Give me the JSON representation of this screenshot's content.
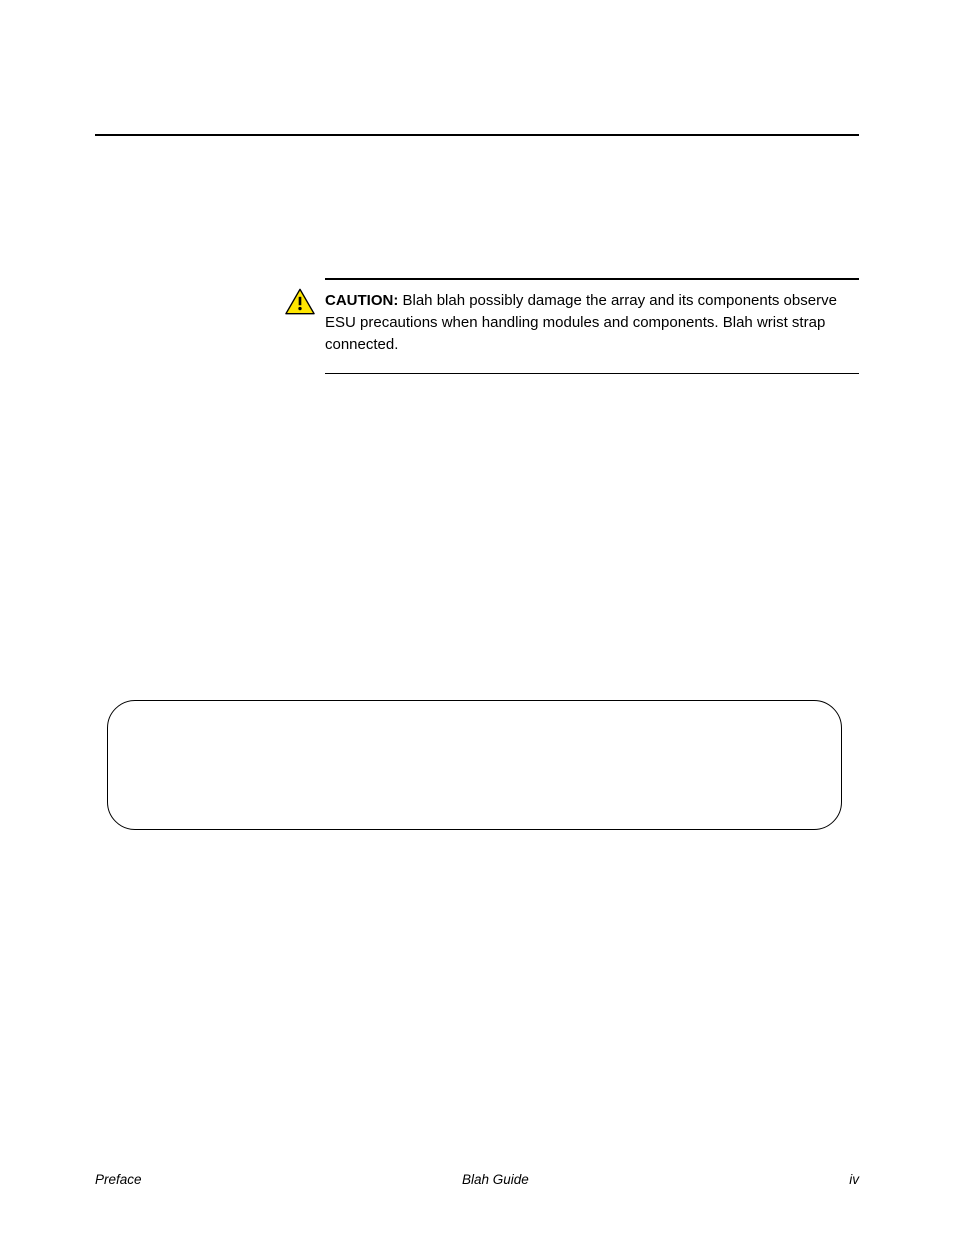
{
  "caution": {
    "label": "CAUTION:",
    "text": "Blah blah possibly damage the array and its components observe ESU precautions when handling modules and components. Blah wrist strap connected."
  },
  "footer": {
    "left": "Preface",
    "center": "Blah Guide",
    "right": "iv"
  }
}
